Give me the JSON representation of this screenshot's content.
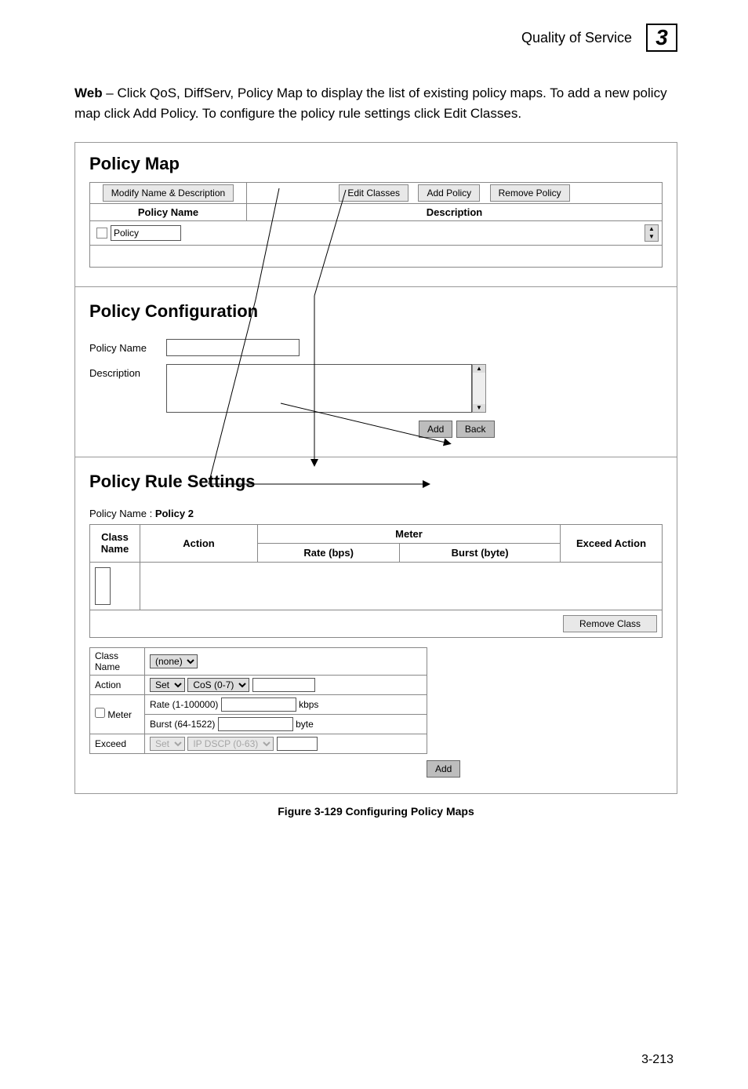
{
  "header": {
    "section": "Quality of Service",
    "chapter": "3"
  },
  "intro": {
    "lead": "Web",
    "text": " – Click QoS, DiffServ, Policy Map to display the list of existing policy maps. To add a new policy map click Add Policy. To configure the policy rule settings click Edit Classes."
  },
  "policy_map": {
    "title": "Policy Map",
    "buttons": {
      "modify": "Modify Name & Description",
      "edit": "Edit Classes",
      "add": "Add Policy",
      "remove": "Remove Policy"
    },
    "columns": {
      "name": "Policy Name",
      "desc": "Description"
    },
    "row0": {
      "value": "Policy"
    }
  },
  "policy_config": {
    "title": "Policy Configuration",
    "labels": {
      "name": "Policy Name",
      "desc": "Description"
    },
    "buttons": {
      "add": "Add",
      "back": "Back"
    }
  },
  "policy_rule": {
    "title": "Policy Rule Settings",
    "name_label": "Policy Name : ",
    "name_value": "Policy 2",
    "columns": {
      "class": "Class Name",
      "action": "Action",
      "meter": "Meter",
      "rate": "Rate (bps)",
      "burst": "Burst (byte)",
      "exceed": "Exceed Action"
    },
    "buttons": {
      "remove": "Remove Class",
      "add": "Add"
    },
    "form": {
      "class_label": "Class Name",
      "class_value": "(none)",
      "action_label": "Action",
      "action_sel": "Set",
      "action_type": "CoS (0-7)",
      "meter_label": "Meter",
      "meter_checked": false,
      "rate_label": "Rate (1-100000)",
      "rate_unit": "kbps",
      "burst_label": "Burst (64-1522)",
      "burst_unit": "byte",
      "exceed_label": "Exceed",
      "exceed_sel": "Set",
      "exceed_type": "IP DSCP (0-63)"
    }
  },
  "caption": "Figure 3-129  Configuring Policy Maps",
  "pagenum": "3-213"
}
